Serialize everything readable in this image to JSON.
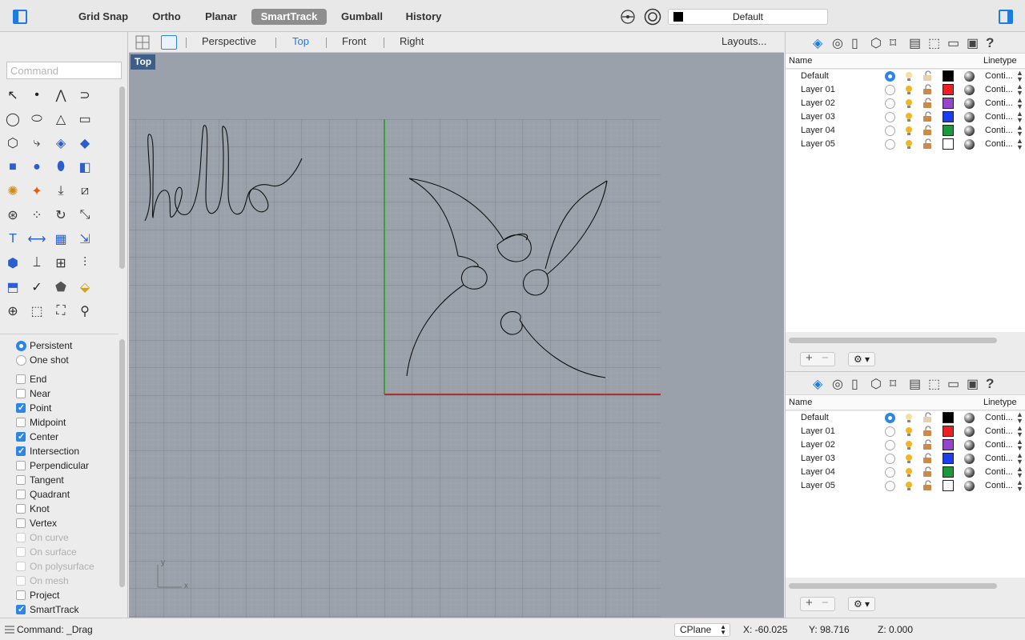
{
  "toolbar": {
    "grid_snap": "Grid Snap",
    "ortho": "Ortho",
    "planar": "Planar",
    "smarttrack": "SmartTrack",
    "gumball": "Gumball",
    "history": "History",
    "current_layer": "Default",
    "current_layer_color": "#000000"
  },
  "command": {
    "placeholder": "Command",
    "status": "Command: _Drag"
  },
  "viewport_tabs": [
    "Perspective",
    "Top",
    "Front",
    "Right"
  ],
  "active_viewport": "Top",
  "layouts_label": "Layouts...",
  "viewport": {
    "label": "Top",
    "axis_x": "x",
    "axis_y": "y",
    "background": "#9aa1ab",
    "x_axis_color": "#b03030",
    "y_axis_color": "#3aa03a"
  },
  "osnap": {
    "mode_persistent": "Persistent",
    "mode_one_shot": "One shot",
    "items": [
      {
        "label": "End",
        "checked": false,
        "enabled": true
      },
      {
        "label": "Near",
        "checked": false,
        "enabled": true
      },
      {
        "label": "Point",
        "checked": true,
        "enabled": true
      },
      {
        "label": "Midpoint",
        "checked": false,
        "enabled": true
      },
      {
        "label": "Center",
        "checked": true,
        "enabled": true
      },
      {
        "label": "Intersection",
        "checked": true,
        "enabled": true
      },
      {
        "label": "Perpendicular",
        "checked": false,
        "enabled": true
      },
      {
        "label": "Tangent",
        "checked": false,
        "enabled": true
      },
      {
        "label": "Quadrant",
        "checked": false,
        "enabled": true
      },
      {
        "label": "Knot",
        "checked": false,
        "enabled": true
      },
      {
        "label": "Vertex",
        "checked": false,
        "enabled": true
      },
      {
        "label": "On curve",
        "checked": false,
        "enabled": false
      },
      {
        "label": "On surface",
        "checked": false,
        "enabled": false
      },
      {
        "label": "On polysurface",
        "checked": false,
        "enabled": false
      },
      {
        "label": "On mesh",
        "checked": false,
        "enabled": false
      },
      {
        "label": "Project",
        "checked": false,
        "enabled": true
      },
      {
        "label": "SmartTrack",
        "checked": true,
        "enabled": true
      }
    ]
  },
  "layers_panel": {
    "col_name": "Name",
    "col_linetype": "Linetype",
    "rows": [
      {
        "name": "Default",
        "color": "#000000",
        "current": true,
        "linetype": "Conti..."
      },
      {
        "name": "Layer 01",
        "color": "#ee2222",
        "current": false,
        "linetype": "Conti..."
      },
      {
        "name": "Layer 02",
        "color": "#9944cc",
        "current": false,
        "linetype": "Conti..."
      },
      {
        "name": "Layer 03",
        "color": "#1a3ef0",
        "current": false,
        "linetype": "Conti..."
      },
      {
        "name": "Layer 04",
        "color": "#1a9a3a",
        "current": false,
        "linetype": "Conti..."
      },
      {
        "name": "Layer 05",
        "color": "#ffffff",
        "current": false,
        "linetype": "Conti..."
      }
    ]
  },
  "layers_panel_2": {
    "col_name": "Name",
    "col_linetype": "Linetype",
    "rows": [
      {
        "name": "Default",
        "color": "#000000",
        "current": true,
        "linetype": "Conti..."
      },
      {
        "name": "Layer 01",
        "color": "#ee2222",
        "current": false,
        "linetype": "Conti..."
      },
      {
        "name": "Layer 02",
        "color": "#9944cc",
        "current": false,
        "linetype": "Conti..."
      },
      {
        "name": "Layer 03",
        "color": "#1a3ef0",
        "current": false,
        "linetype": "Conti..."
      },
      {
        "name": "Layer 04",
        "color": "#1a9a3a",
        "current": false,
        "linetype": "Conti..."
      },
      {
        "name": "Layer 05",
        "color": "#ffffff",
        "current": false,
        "linetype": "Conti..."
      }
    ]
  },
  "status": {
    "cplane": "CPlane",
    "x": "X: -60.025",
    "y": "Y: 98.716",
    "z": "Z: 0.000"
  }
}
